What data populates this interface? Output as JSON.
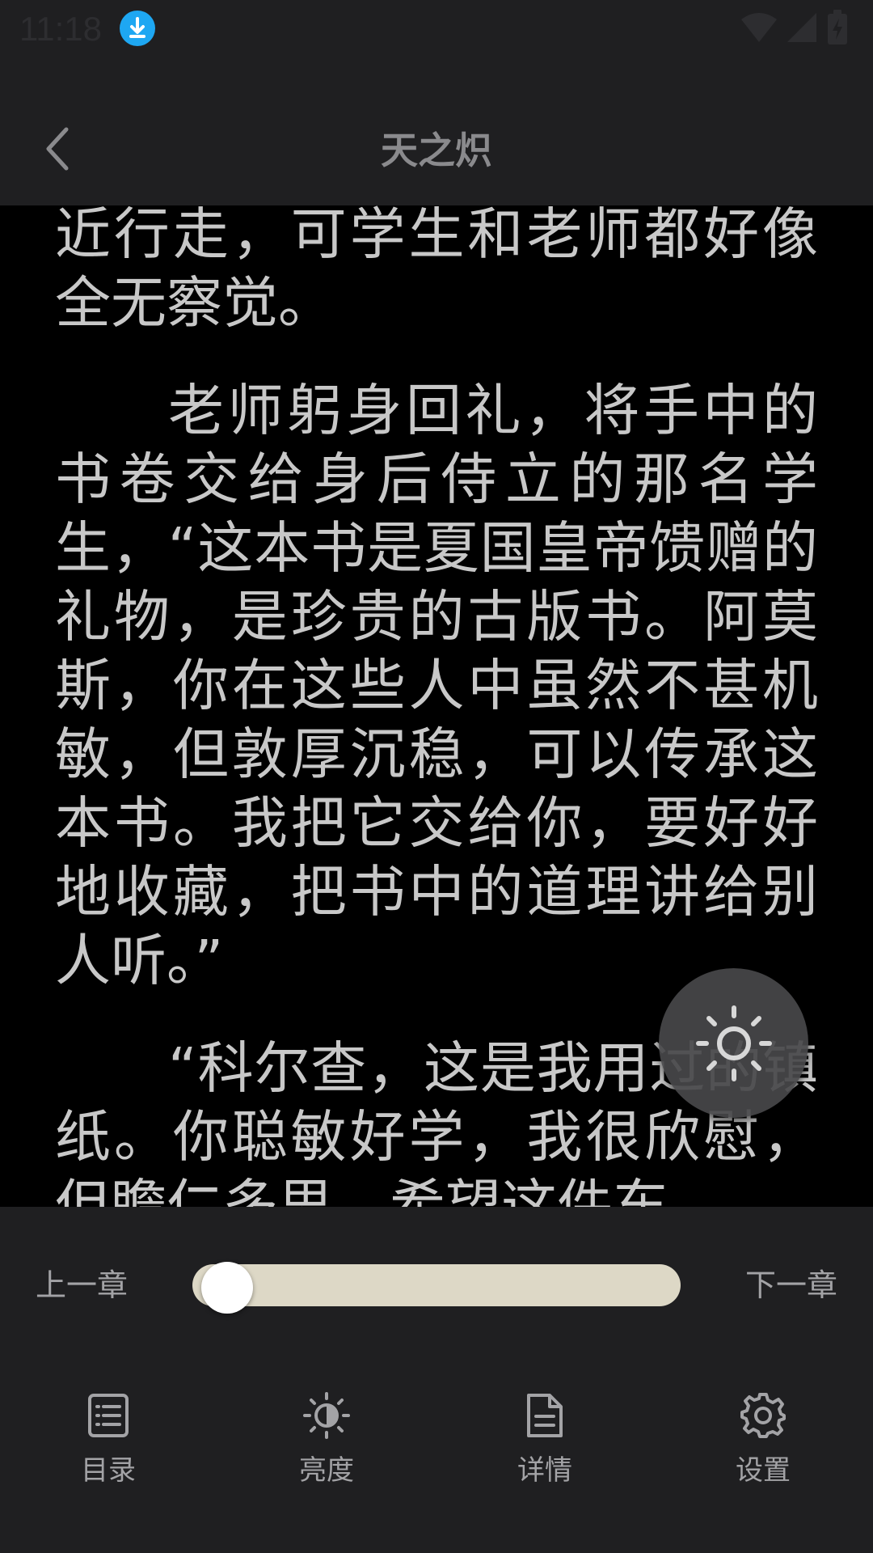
{
  "status_bar": {
    "time": "11:18",
    "download_icon": "download-icon",
    "wifi_icon": "wifi-icon",
    "signal_icon": "signal-icon",
    "battery_icon": "battery-charging-icon"
  },
  "header": {
    "back_icon": "chevron-left-icon",
    "title": "天之炽"
  },
  "content": {
    "paragraphs": [
      "近行走，可学生和老师都好像全无察觉。",
      "老师躬身回礼，将手中的书卷交给身后侍立的那名学生，“这本书是夏国皇帝馈赠的礼物，是珍贵的古版书。阿莫斯，你在这些人中虽然不甚机敏，但敦厚沉稳，可以传承这本书。我把它交给你，要好好地收藏，把书中的道理讲给别人听。”",
      "“科尔查，这是我用过的镇纸。你聪敏好学，我很欣慰，但瞻仁多思，希望这件东"
    ]
  },
  "fab": {
    "icon": "sun-icon"
  },
  "chapter_nav": {
    "prev_label": "上一章",
    "next_label": "下一章",
    "progress": 0.02
  },
  "bottom_nav": {
    "items": [
      {
        "label": "目录",
        "icon": "list-icon"
      },
      {
        "label": "亮度",
        "icon": "brightness-icon"
      },
      {
        "label": "详情",
        "icon": "document-icon"
      },
      {
        "label": "设置",
        "icon": "gear-icon"
      }
    ]
  },
  "colors": {
    "panel_bg": "#1f1f21",
    "page_bg": "#000000",
    "text": "#c8c8c8",
    "slider_track": "#ddd8c6",
    "accent_download": "#1ea7f2"
  }
}
